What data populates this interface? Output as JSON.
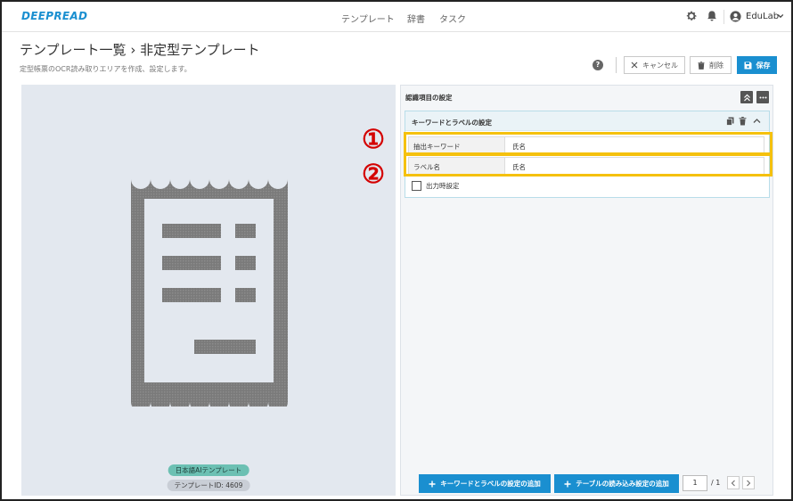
{
  "nav": {
    "logo": "DEEPREAD",
    "links": [
      "テンプレート",
      "辞書",
      "タスク"
    ],
    "user": "EduLab"
  },
  "header": {
    "title": "テンプレート一覧 › 非定型テンプレート",
    "subtitle": "定型帳票のOCR読み取りエリアを作成、設定します。",
    "help": "?",
    "buttons": {
      "cancel": "キャンセル",
      "delete": "削除",
      "save": "保存"
    }
  },
  "preview": {
    "badge_lang": "日本語AIテンプレート",
    "badge_id": "テンプレートID: 4609"
  },
  "panel": {
    "title": "認識項目の設定",
    "card": {
      "title": "キーワードとラベルの設定",
      "rows": [
        {
          "label": "抽出キーワード",
          "value": "氏名"
        },
        {
          "label": "ラベル名",
          "value": "氏名"
        }
      ],
      "output_label": "出力時設定"
    },
    "add_keyword_label": "キーワードとラベルの設定の追加",
    "add_table_label": "テーブルの読み込み設定の追加",
    "page_current": "1",
    "page_total": "/ 1"
  },
  "annotations": {
    "callout1": "①",
    "callout2": "②"
  },
  "colors": {
    "primary": "#1a8fd0",
    "highlight": "#f5c10e",
    "callout": "#d40000",
    "teal_badge": "#6cc0b3"
  }
}
